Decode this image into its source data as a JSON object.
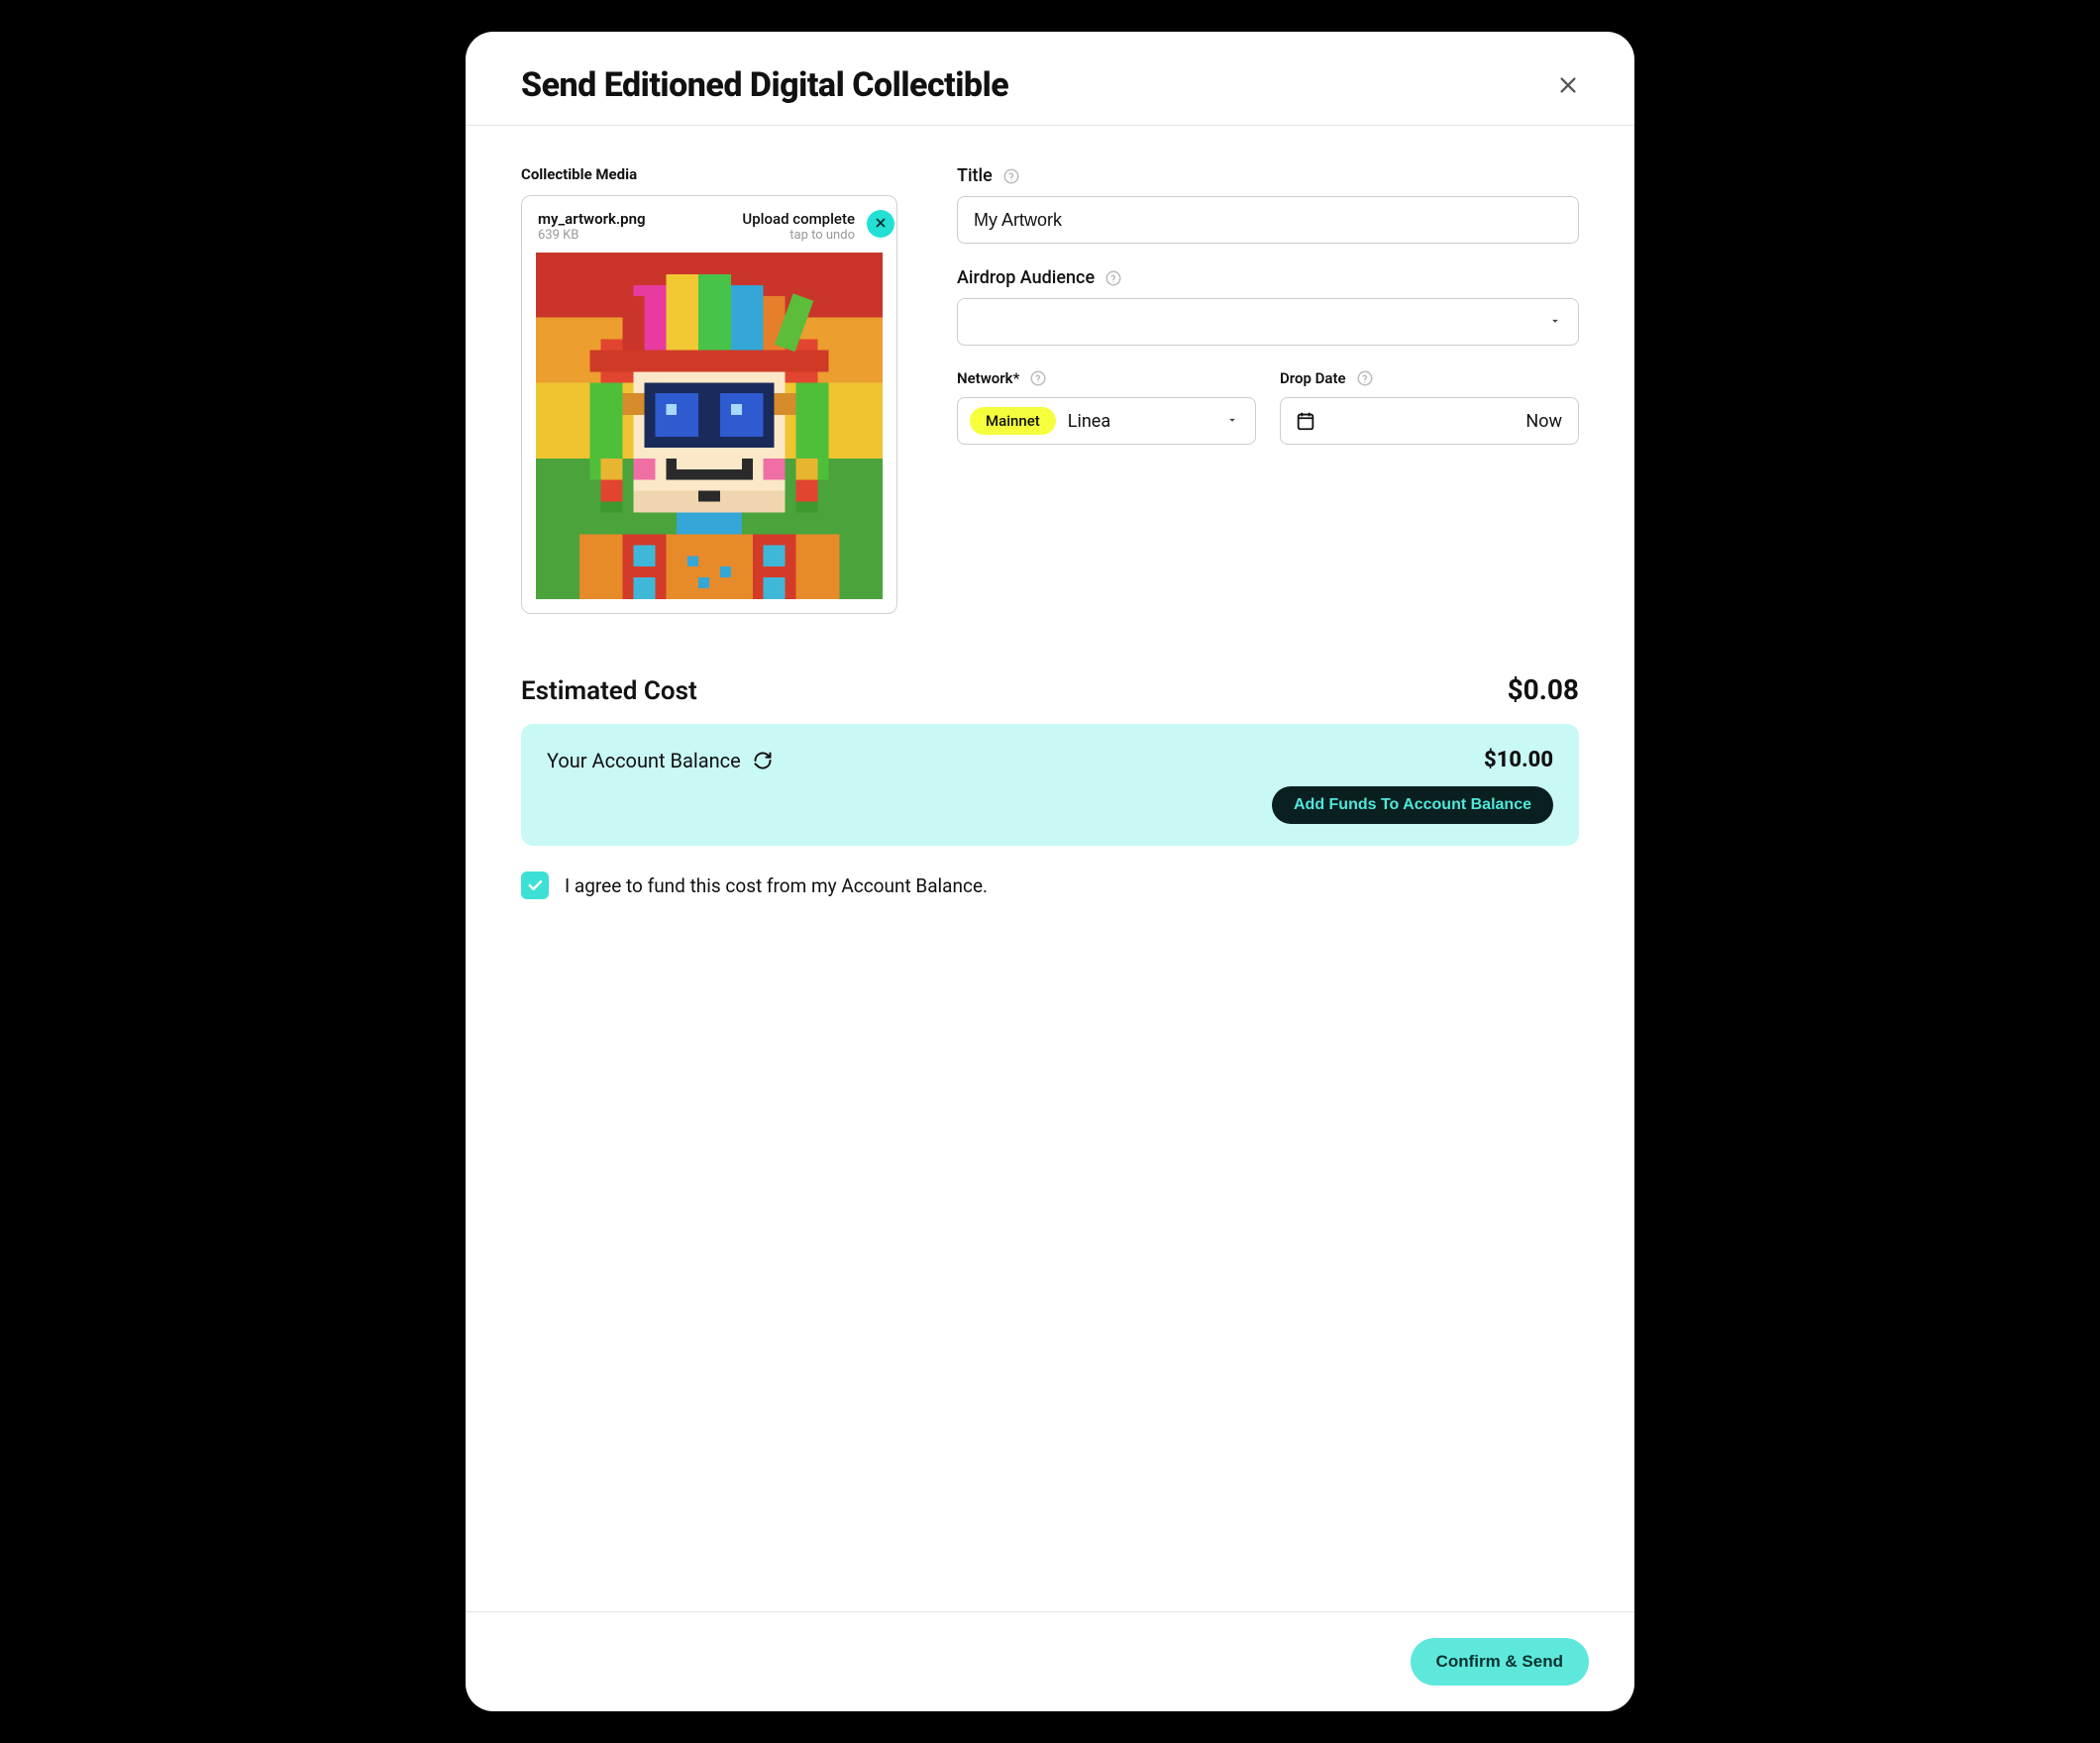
{
  "modal": {
    "title": "Send Editioned Digital Collectible"
  },
  "media": {
    "section_label": "Collectible Media",
    "filename": "my_artwork.png",
    "filesize": "639 KB",
    "upload_status": "Upload complete",
    "undo_hint": "tap to undo"
  },
  "form": {
    "title_label": "Title",
    "title_value": "My Artwork",
    "audience_label": "Airdrop Audience",
    "audience_value": "",
    "network_label": "Network*",
    "network_pill": "Mainnet",
    "network_name": "Linea",
    "drop_date_label": "Drop Date",
    "drop_date_value": "Now"
  },
  "cost": {
    "title": "Estimated Cost",
    "amount": "$0.08",
    "balance_label": "Your Account Balance",
    "balance_amount": "$10.00",
    "add_funds_label": "Add Funds To Account Balance",
    "agree_text": "I agree to fund this cost from my Account Balance.",
    "agree_checked": true
  },
  "footer": {
    "confirm_label": "Confirm & Send"
  }
}
